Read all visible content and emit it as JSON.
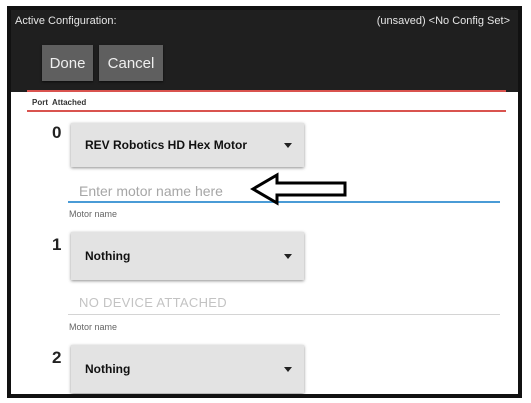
{
  "header": {
    "title": "Active Configuration:",
    "status": "(unsaved) <No Config Set>"
  },
  "buttons": {
    "done": "Done",
    "cancel": "Cancel"
  },
  "columns": {
    "port": "Port",
    "attached": "Attached"
  },
  "ports": [
    {
      "number": "0",
      "device": "REV Robotics HD Hex Motor",
      "name_placeholder": "Enter motor name here",
      "name_label": "Motor name"
    },
    {
      "number": "1",
      "device": "Nothing",
      "status_text": "NO DEVICE ATTACHED",
      "name_label": "Motor name"
    },
    {
      "number": "2",
      "device": "Nothing"
    }
  ],
  "colors": {
    "topbar": "#1f1f1f",
    "button": "#5f5f5f",
    "divider_red": "#d9534f",
    "input_underline": "#4a9bd6"
  }
}
